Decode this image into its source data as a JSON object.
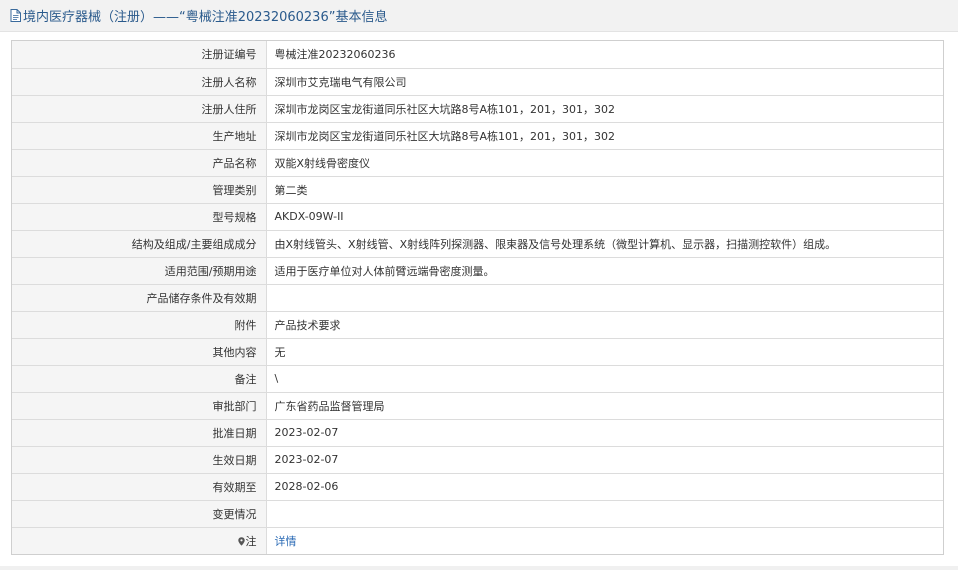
{
  "header": {
    "title": "境内医疗器械（注册）——“粤械注准20232060236”基本信息"
  },
  "rows": [
    {
      "label": "注册证编号",
      "value": "粤械注准20232060236"
    },
    {
      "label": "注册人名称",
      "value": "深圳市艾克瑞电气有限公司"
    },
    {
      "label": "注册人住所",
      "value": "深圳市龙岗区宝龙街道同乐社区大坑路8号A栋101，201，301，302"
    },
    {
      "label": "生产地址",
      "value": "深圳市龙岗区宝龙街道同乐社区大坑路8号A栋101，201，301，302"
    },
    {
      "label": "产品名称",
      "value": "双能X射线骨密度仪"
    },
    {
      "label": "管理类别",
      "value": "第二类"
    },
    {
      "label": "型号规格",
      "value": "AKDX-09W-II"
    },
    {
      "label": "结构及组成/主要组成成分",
      "value": "由X射线管头、X射线管、X射线阵列探测器、限束器及信号处理系统（微型计算机、显示器，扫描测控软件）组成。"
    },
    {
      "label": "适用范围/预期用途",
      "value": "适用于医疗单位对人体前臂远端骨密度测量。"
    },
    {
      "label": "产品储存条件及有效期",
      "value": ""
    },
    {
      "label": "附件",
      "value": "产品技术要求"
    },
    {
      "label": "其他内容",
      "value": "无"
    },
    {
      "label": "备注",
      "value": "\\"
    },
    {
      "label": "审批部门",
      "value": "广东省药品监督管理局"
    },
    {
      "label": "批准日期",
      "value": "2023-02-07"
    },
    {
      "label": "生效日期",
      "value": "2023-02-07"
    },
    {
      "label": "有效期至",
      "value": "2028-02-06"
    },
    {
      "label": "变更情况",
      "value": ""
    }
  ],
  "note_row": {
    "label": "注",
    "link_text": "详情",
    "icon": "pin-icon"
  },
  "colors": {
    "header_text": "#2a5a8c",
    "link": "#2a6ab5",
    "label_bg": "#f5f5f5"
  }
}
